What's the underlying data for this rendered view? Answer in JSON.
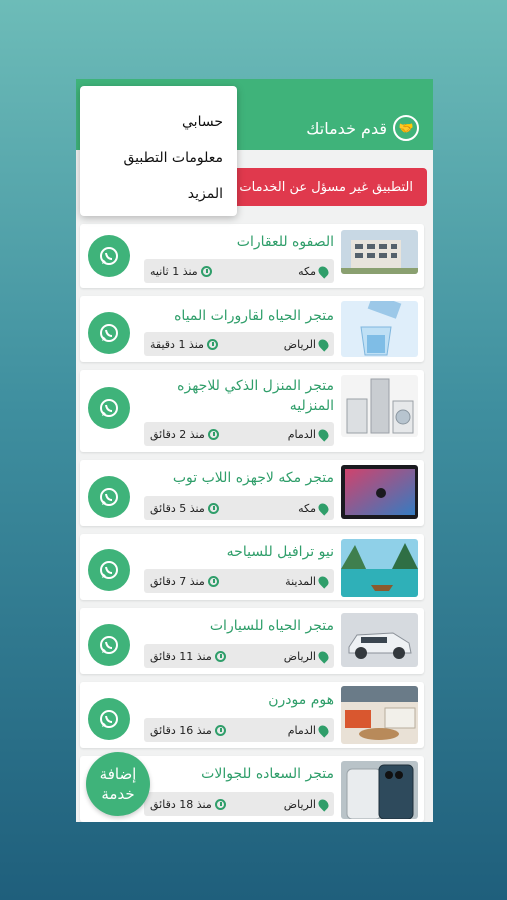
{
  "appbar": {
    "title": "قدم خدماتك",
    "logo": "handshake-icon"
  },
  "menu": {
    "items": [
      "حسابي",
      "معلومات التطبيق",
      "المزيد"
    ]
  },
  "banner": {
    "text": "التطبيق غير مسؤل عن الخدمات المقدمة"
  },
  "colors": {
    "primary": "#3fb37a",
    "title": "#2f9e6a",
    "alert": "#e0394d"
  },
  "listings": [
    {
      "title": "الصفوه للعقارات",
      "city": "مكه",
      "time": "منذ 1 ثانيه",
      "image": "building"
    },
    {
      "title": "متجر الحياه لقارورات المياه",
      "city": "الرياض",
      "time": "منذ 1 دقيقة",
      "image": "water"
    },
    {
      "title": "متجر المنزل الذكي للاجهزه المنزليه",
      "city": "الدمام",
      "time": "منذ 2 دقائق",
      "image": "appliances"
    },
    {
      "title": "متجر مكه لاجهزه اللاب توب",
      "city": "مكه",
      "time": "منذ 5 دقائق",
      "image": "laptop"
    },
    {
      "title": "نيو ترافيل للسياحه",
      "city": "المدينة",
      "time": "منذ 7 دقائق",
      "image": "travel"
    },
    {
      "title": "متجر الحياه للسيارات",
      "city": "الرياض",
      "time": "منذ 11 دقائق",
      "image": "car"
    },
    {
      "title": "هوم مودرن",
      "city": "الدمام",
      "time": "منذ 16 دقائق",
      "image": "furniture"
    },
    {
      "title": "متجر السعاده للجوالات",
      "city": "الرياض",
      "time": "منذ 18 دقائق",
      "image": "phone"
    }
  ],
  "fab": {
    "line1": "إضافة",
    "line2": "خدمة"
  }
}
